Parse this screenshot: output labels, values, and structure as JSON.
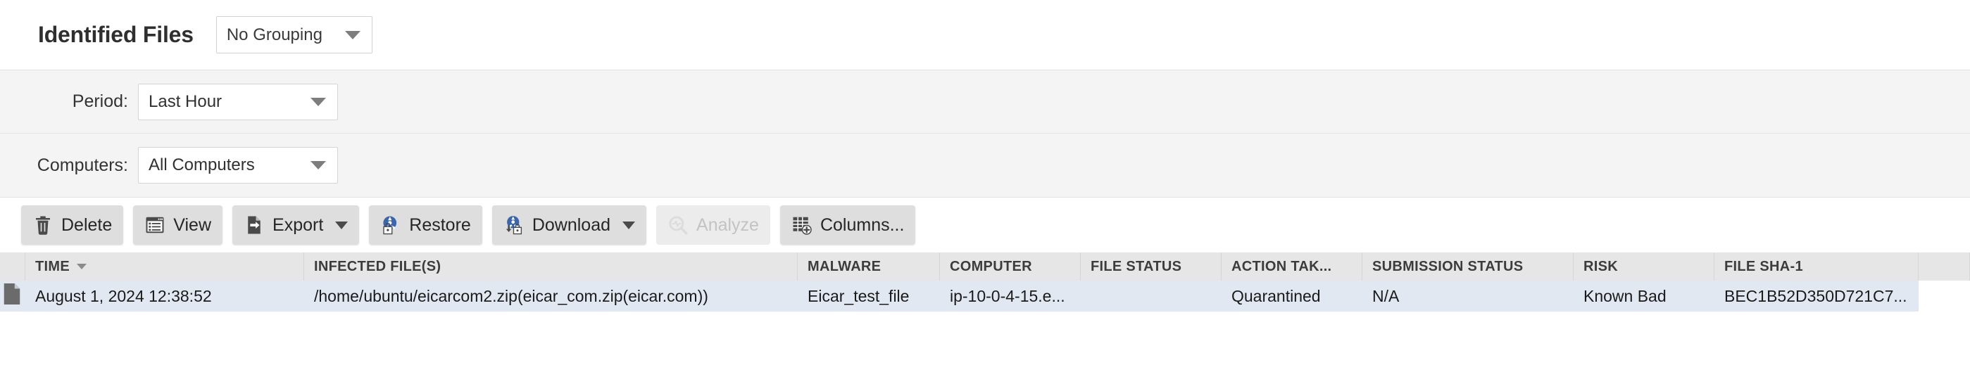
{
  "header": {
    "title": "Identified Files",
    "grouping": {
      "name": "grouping-select",
      "value": "No Grouping",
      "caret_icon": "chevron-down-icon"
    }
  },
  "filters": [
    {
      "label": "Period:",
      "value": "Last Hour",
      "name": "period"
    },
    {
      "label": "Computers:",
      "value": "All Computers",
      "name": "computers"
    }
  ],
  "toolbar": {
    "buttons": [
      {
        "label": "Delete",
        "icon": "trash-icon",
        "disabled": false,
        "has_menu": false
      },
      {
        "label": "View",
        "icon": "list-window-icon",
        "disabled": false,
        "has_menu": false
      },
      {
        "label": "Export",
        "icon": "export-file-icon",
        "disabled": false,
        "has_menu": true
      },
      {
        "label": "Restore",
        "icon": "restore-lock-icon",
        "disabled": false,
        "has_menu": false
      },
      {
        "label": "Download",
        "icon": "download-lock-icon",
        "disabled": false,
        "has_menu": true
      },
      {
        "label": "Analyze",
        "icon": "analyze-search-icon",
        "disabled": true,
        "has_menu": false
      },
      {
        "label": "Columns...",
        "icon": "columns-add-icon",
        "disabled": false,
        "has_menu": false
      }
    ]
  },
  "table": {
    "columns": [
      {
        "key": "icon",
        "label": ""
      },
      {
        "key": "time",
        "label": "TIME",
        "sorted": true,
        "sort_icon": "sort-desc-icon"
      },
      {
        "key": "file",
        "label": "INFECTED FILE(S)"
      },
      {
        "key": "mal",
        "label": "MALWARE"
      },
      {
        "key": "comp",
        "label": "COMPUTER"
      },
      {
        "key": "fstat",
        "label": "FILE STATUS"
      },
      {
        "key": "action",
        "label": "ACTION TAK..."
      },
      {
        "key": "sub",
        "label": "SUBMISSION STATUS"
      },
      {
        "key": "risk",
        "label": "RISK"
      },
      {
        "key": "sha",
        "label": "FILE SHA-1"
      }
    ],
    "rows": [
      {
        "selected": true,
        "row_icon": "file-document-icon",
        "time": "August 1, 2024 12:38:52",
        "file": "/home/ubuntu/eicarcom2.zip(eicar_com.zip(eicar.com))",
        "mal": "Eicar_test_file",
        "comp": "ip-10-0-4-15.e...",
        "fstat": "",
        "action": "Quarantined",
        "sub": "N/A",
        "risk": "Known Bad",
        "sha": "BEC1B52D350D721C7..."
      }
    ]
  },
  "colors": {
    "row_selected": "#e2e8f2",
    "header_bg": "#e6e6e6",
    "filter_bg": "#f4f4f4",
    "button_bg": "#dedede",
    "icon_blue": "#3a66b0"
  }
}
